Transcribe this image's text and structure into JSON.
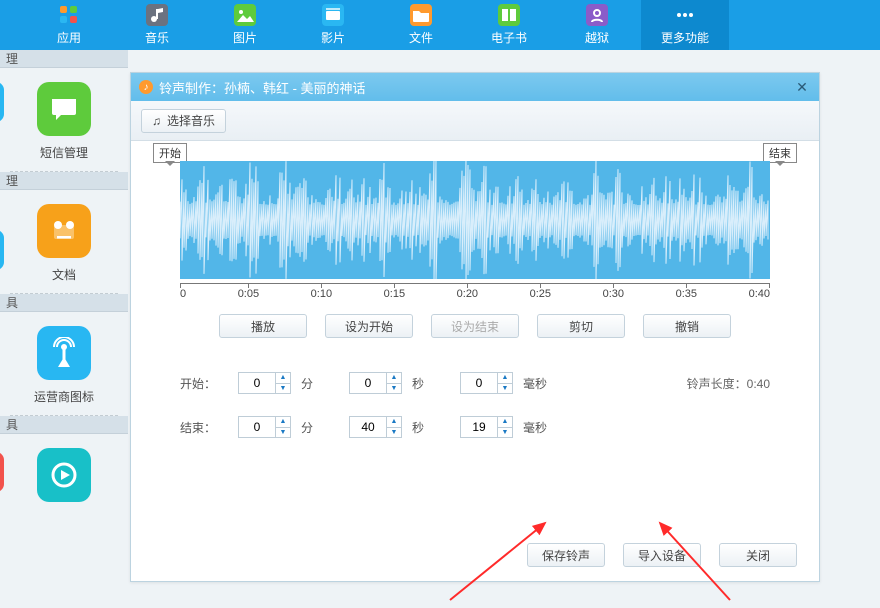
{
  "nav": {
    "items": [
      {
        "label": "应用",
        "icon": "apps-icon"
      },
      {
        "label": "音乐",
        "icon": "music-icon"
      },
      {
        "label": "图片",
        "icon": "photo-icon"
      },
      {
        "label": "影片",
        "icon": "video-icon"
      },
      {
        "label": "文件",
        "icon": "file-icon"
      },
      {
        "label": "电子书",
        "icon": "ebook-icon"
      },
      {
        "label": "越狱",
        "icon": "jailbreak-icon"
      },
      {
        "label": "更多功能",
        "icon": "more-icon",
        "active": true
      }
    ]
  },
  "sidebar": {
    "groups": [
      {
        "title": "理",
        "tiles": [
          {
            "color": "green",
            "label": "短信管理",
            "icon": "sms-icon"
          }
        ]
      },
      {
        "title": "理",
        "tiles": [
          {
            "color": "orange",
            "label": "文档",
            "icon": "doc-icon"
          }
        ]
      },
      {
        "title": "具",
        "tiles": [
          {
            "color": "sky",
            "label": "运营商图标",
            "icon": "carrier-icon"
          }
        ]
      },
      {
        "title": "具",
        "tiles": [
          {
            "color": "teal",
            "label": "",
            "icon": "play-icon"
          }
        ]
      }
    ],
    "edge_tiles": [
      {
        "color": "sky"
      },
      {
        "color": "sky"
      },
      {
        "color": "red"
      }
    ]
  },
  "dialog": {
    "title": "铃声制作：孙楠、韩红 - 美丽的神话",
    "select_music": "选择音乐",
    "tag_start": "开始",
    "tag_end": "结束",
    "timescale": [
      "0",
      "0:05",
      "0:10",
      "0:15",
      "0:20",
      "0:25",
      "0:30",
      "0:35",
      "0:40"
    ],
    "action_buttons": {
      "play": "播放",
      "set_start": "设为开始",
      "set_end": "设为结束",
      "cut": "剪切",
      "undo": "撤销"
    },
    "inputs": {
      "start_label": "开始：",
      "end_label": "结束：",
      "unit_min": "分",
      "unit_sec": "秒",
      "unit_ms": "毫秒",
      "start_min": "0",
      "start_sec": "0",
      "start_ms": "0",
      "end_min": "0",
      "end_sec": "40",
      "end_ms": "19",
      "length_label": "铃声长度：0:40"
    },
    "footer": {
      "save": "保存铃声",
      "import": "导入设备",
      "close": "关闭"
    }
  }
}
